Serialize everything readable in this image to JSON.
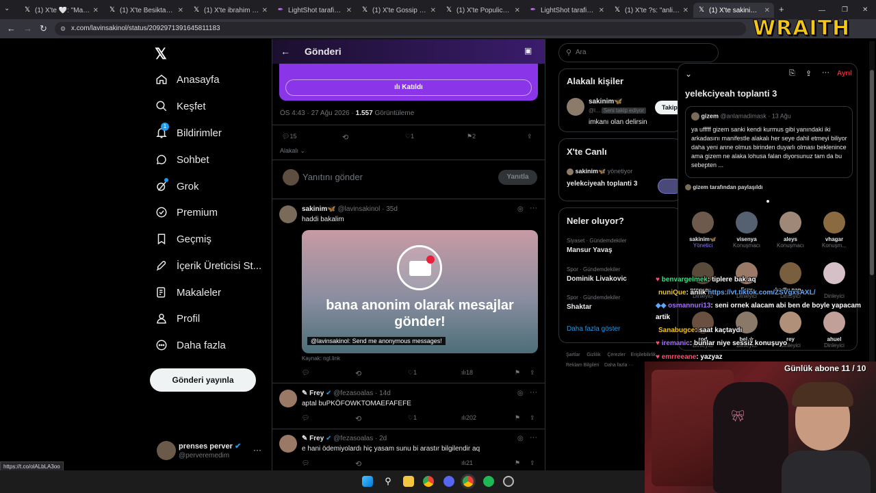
{
  "browser": {
    "tabs": [
      {
        "title": "(1) X'te 🤍: \"Manifest...",
        "icon": "x-logo"
      },
      {
        "title": "(1) X'te Besiktasliyim...",
        "icon": "x-logo"
      },
      {
        "title": "(1) X'te ibrahim Hask...",
        "icon": "x-logo"
      },
      {
        "title": "LightShot tarafindan...",
        "icon": "lightshot-feather"
      },
      {
        "title": "(1) X'te Gossip Maga...",
        "icon": "x-logo"
      },
      {
        "title": "(1) X'te Populicc: \"Me...",
        "icon": "x-logo"
      },
      {
        "title": "LightShot tarafindan...",
        "icon": "lightshot-feather"
      },
      {
        "title": "(1) X'te ?s: \"anlik giz...",
        "icon": "x-logo"
      },
      {
        "title": "(1) X'te sakinim🦋...",
        "icon": "x-logo"
      }
    ],
    "url": "x.com/lavinsakinol/status/2092971391645811183",
    "overlay_logo": "WRAITH"
  },
  "nav": {
    "items": [
      {
        "label": "Anasayfa",
        "icon": "home-icon"
      },
      {
        "label": "Keşfet",
        "icon": "search-icon"
      },
      {
        "label": "Bildirimler",
        "icon": "bell-icon",
        "badge": "1"
      },
      {
        "label": "Sohbet",
        "icon": "chat-icon"
      },
      {
        "label": "Grok",
        "icon": "grok-icon"
      },
      {
        "label": "Premium",
        "icon": "premium-icon"
      },
      {
        "label": "Geçmiş",
        "icon": "bookmark-icon"
      },
      {
        "label": "İçerik Üreticisi St...",
        "icon": "rocket-icon"
      },
      {
        "label": "Makaleler",
        "icon": "article-icon"
      },
      {
        "label": "Profil",
        "icon": "profile-icon"
      },
      {
        "label": "Daha fazla",
        "icon": "more-icon"
      }
    ],
    "post_button": "Gönderi yayınla",
    "account": {
      "name": "prenses perver",
      "handle": "@perveremedim"
    }
  },
  "main": {
    "title": "Gönderi",
    "join_button": "Katıldı",
    "post_meta": {
      "time": "ÖS 4:43 · 27 Ağu 2026 ·",
      "views": "1.557",
      "views_label": "Görüntüleme"
    },
    "post_actions": {
      "replies": "15",
      "likes": "1",
      "bookmarks": "2"
    },
    "sort_label": "Alakalı",
    "reply_placeholder": "Yanıtını gönder",
    "reply_button": "Yanıtla",
    "replies": [
      {
        "name": "sakinim🦋",
        "handle": "@lavinsakinol · 35d",
        "text": "haddi bakalim",
        "card_title": "bana anonim olarak mesajlar gönder!",
        "card_caption": "@lavinsakinol: Send me anonymous messages!",
        "source": "Kaynak: ngl.link",
        "likes": "1",
        "views": "18"
      },
      {
        "name": "✎ Frey",
        "handle": "@fezasoalas · 14d",
        "text": "aptal buPKÖFOWKTOMAEFAFEFE",
        "likes": "1",
        "views": "202"
      },
      {
        "name": "✎ Frey",
        "handle": "@fezasoalas · 2d",
        "text": "e hani ödemiyolardı hiç yasam sunu bi arastır bilgilendir aq",
        "views": "21"
      }
    ]
  },
  "right": {
    "search_placeholder": "Ara",
    "related_title": "Alakalı kişiler",
    "related_person": {
      "name": "sakinim🦋",
      "handle": "@l...",
      "follows_badge": "Seni takip ediyor",
      "bio": "imkanı olan delirsin",
      "follow_button": "Takip"
    },
    "live_title": "X'te Canlı",
    "live_host": "sakinim🦋",
    "live_host_suffix": "yönetiyor",
    "live_space": "yelekciyeah toplanti 3",
    "trends_title": "Neler oluyor?",
    "trends": [
      {
        "category": "Siyaset · Gündemdekiler",
        "name": "Mansur Yavaş"
      },
      {
        "category": "Spor · Gündemdekiler",
        "name": "Dominik Livakovic"
      },
      {
        "category": "Spor · Gündemdekiler",
        "name": "Shaktar"
      }
    ],
    "show_more": "Daha fazla göster",
    "footer_links": [
      "Şartlar",
      "Gizlilik",
      "Çerezler",
      "Erişilebilirlik",
      "Reklam Bilgileri",
      "Daha fazla ···"
    ]
  },
  "space": {
    "leave_button": "Ayrıl",
    "title": "yelekciyeah toplanti 3",
    "pinned": {
      "name": "gizem",
      "handle": "@anlamadimask · 13 Ağu",
      "text": "ya ufffff gizem sanki kendi kurmus gibi yanındaki iki arkadasını manifestle alakalı her seye dahil etmeyi biliyor daha yeni anne olmus birinden duyarlı olması beklenince ama gizem ne alaka lohusa falan diyorsunuz tam da bu sebepten ..."
    },
    "shared_by": "gizem tarafından paylaşıldı",
    "participants": [
      {
        "name": "sakinim🦋",
        "role": "Yönetici"
      },
      {
        "name": "visenya",
        "role": "Konuşmacı"
      },
      {
        "name": "aleys",
        "role": "Konuşmacı"
      },
      {
        "name": "vhagar",
        "role": "Konuşm..."
      },
      {
        "name": "prenses...",
        "role": "Dinleyici"
      },
      {
        "name": "Frey",
        "role": "Dinleyici"
      },
      {
        "name": "kodlu pan...",
        "role": "Dinleyici"
      },
      {
        "name": "",
        "role": "Dinleyici"
      },
      {
        "name": "rod",
        "role": "Dinleyici"
      },
      {
        "name": "bel ☆",
        "role": "Dinleyici"
      },
      {
        "name": "rey",
        "role": "Dinleyici"
      },
      {
        "name": "ahuel",
        "role": "Dinleyici"
      }
    ]
  },
  "chat": [
    {
      "user": "benvargelmek",
      "msg": ": tiplere bak aq",
      "color": "#3ddc84"
    },
    {
      "user": "nuniQue",
      "msg": ": anlık ",
      "link": "https://vt.tiktok.com/ZSVgxsAXL/",
      "color": "#f5c518"
    },
    {
      "user": "osmannuri13",
      "msg": ": seni ornek alacam abi ben de boyle yapacam",
      "color": "#a970ff"
    },
    {
      "user": "",
      "msg": "artik",
      "color": "#ffffff"
    },
    {
      "user": "Sanabugce",
      "msg": ": saat kaçtaydı",
      "color": "#f5c518"
    },
    {
      "user": "iremanic",
      "msg": ": bunlar niye sessiz konuşuyo",
      "color": "#a970ff"
    },
    {
      "user": "emrreeane",
      "msg": ": yazyaz",
      "color": "#ff4d6d"
    }
  ],
  "subs_counter": "Günlük abone 11 / 10",
  "status_url": "https://t.co/olALbLA3oo",
  "colors": {
    "accent": "#1d9bf0",
    "purple": "#7b2ff7",
    "danger": "#f4212e"
  }
}
